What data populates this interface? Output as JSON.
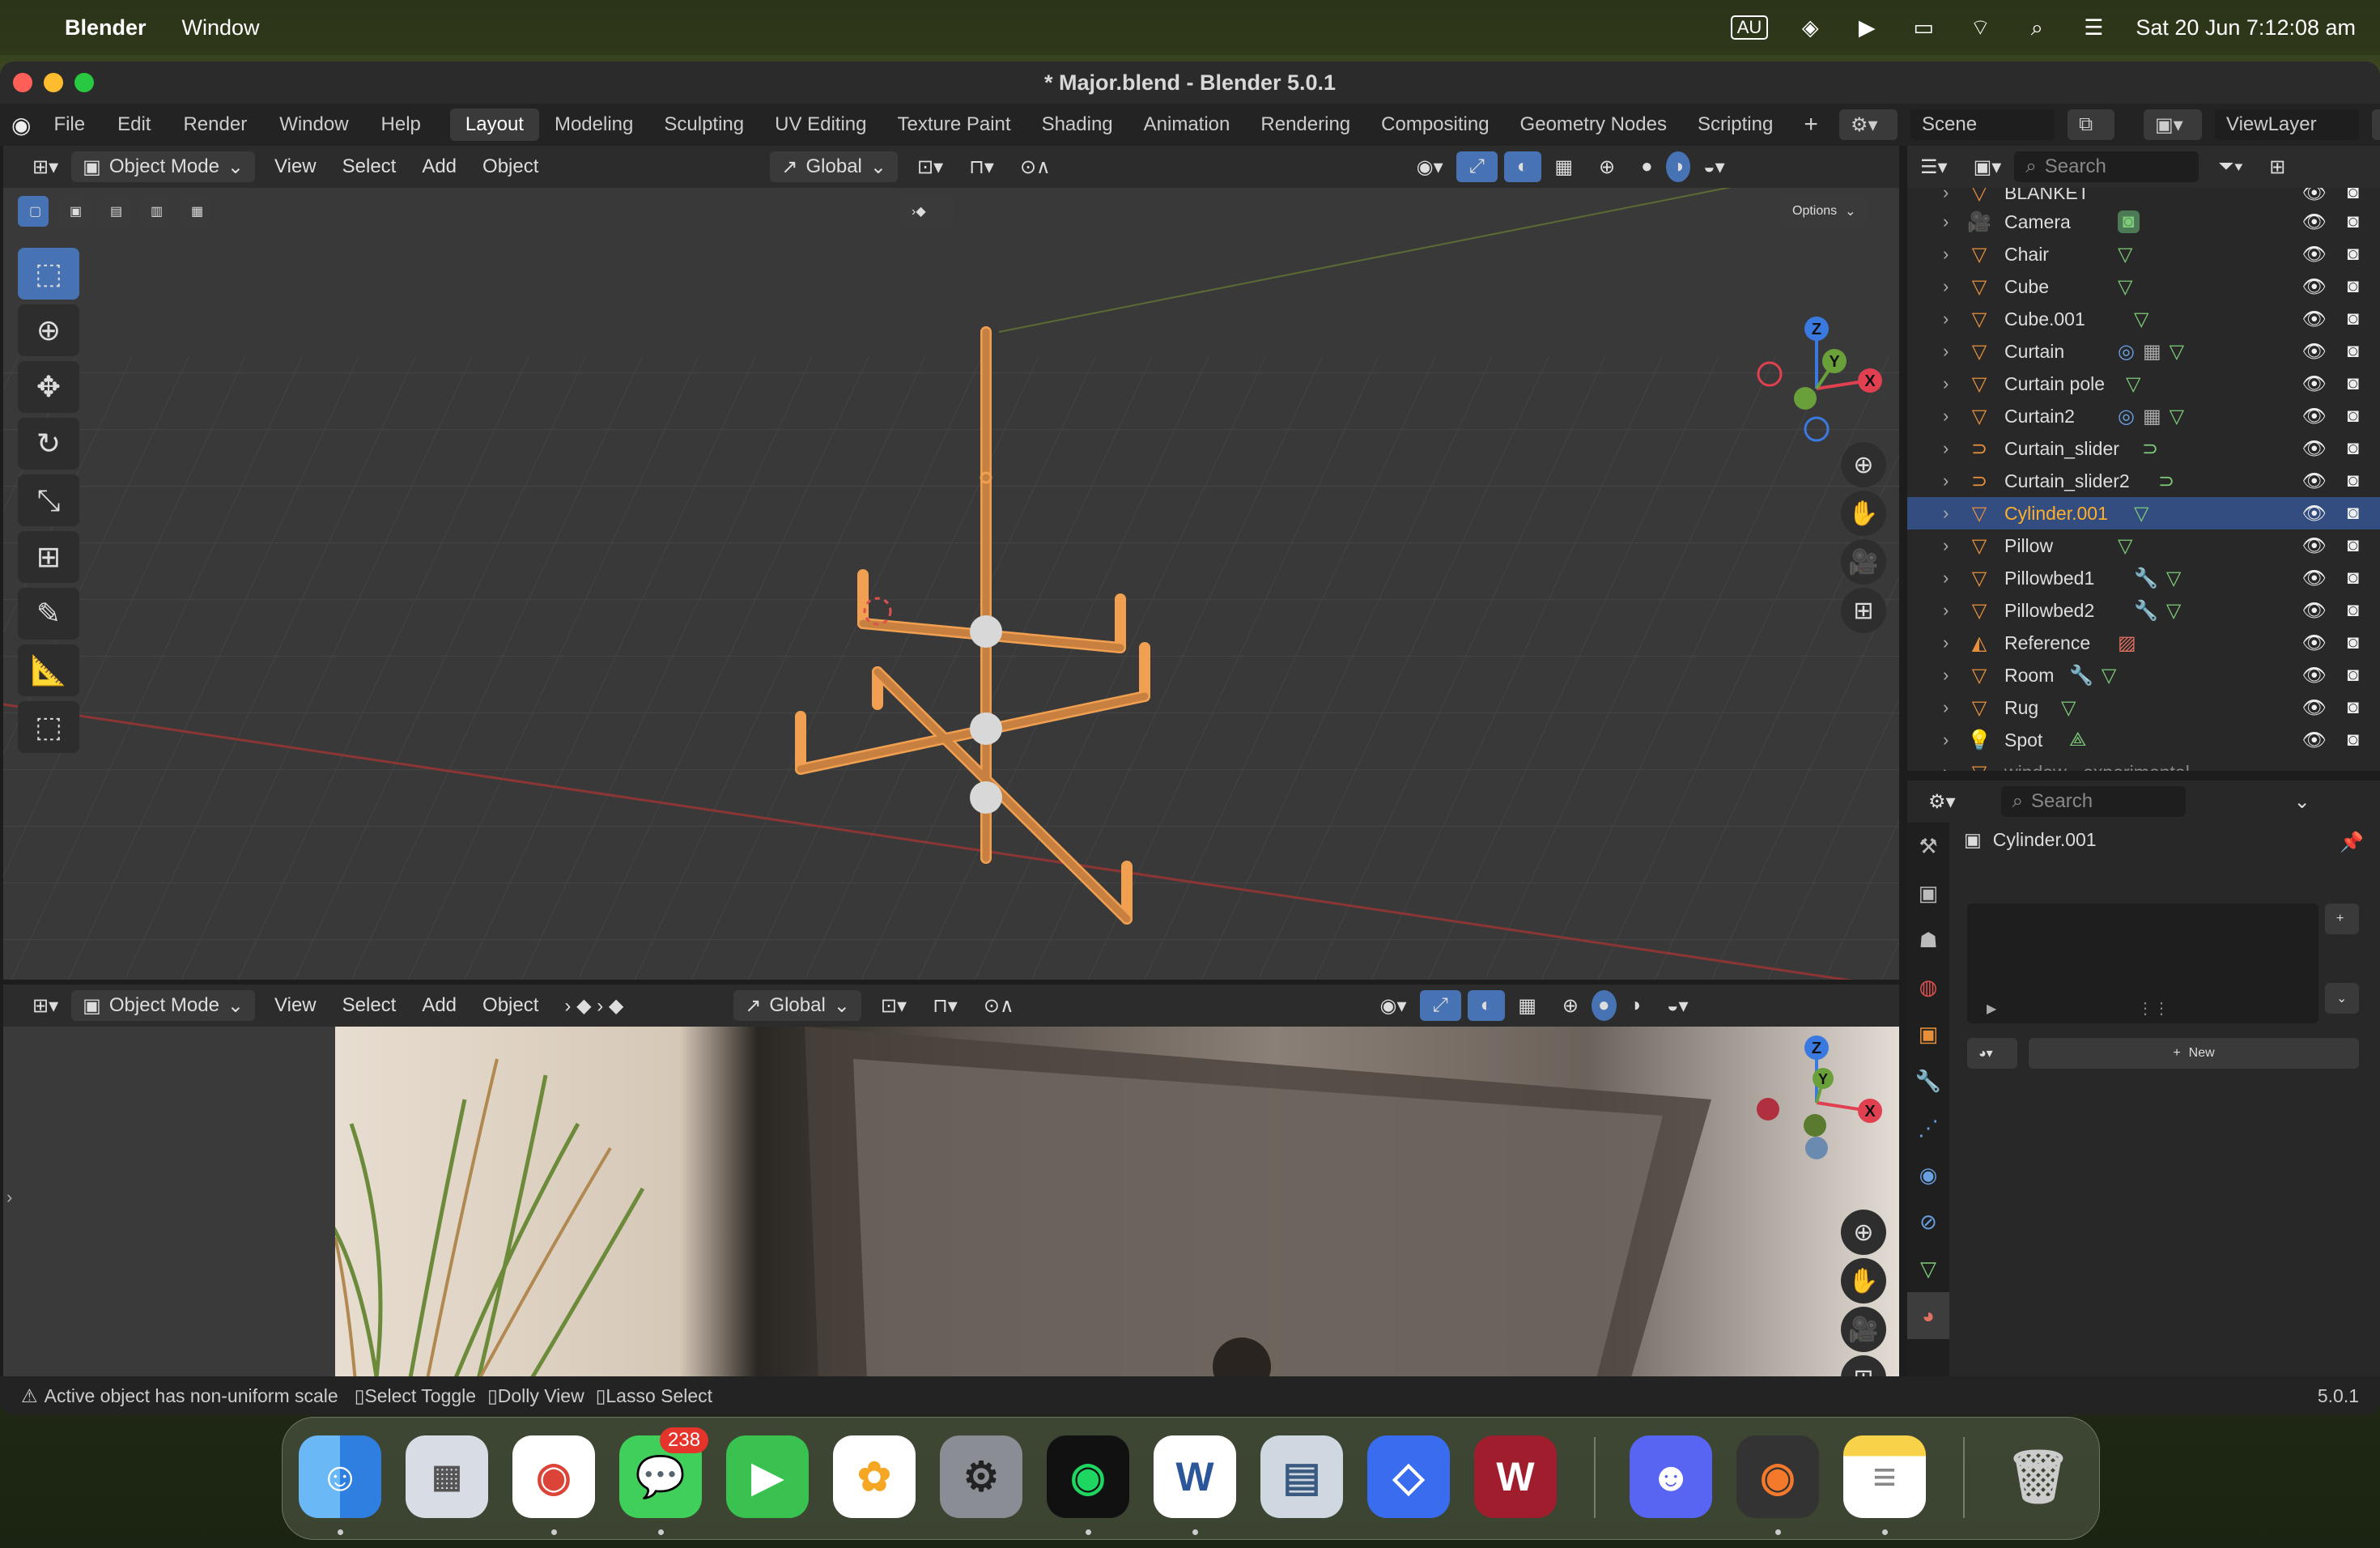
{
  "menubar": {
    "apple": "",
    "app_name": "Blender",
    "menu_window": "Window",
    "locale": "AU",
    "datetime": "Sat 20 Jun  7:12:08 am"
  },
  "window": {
    "title": "* Major.blend - Blender 5.0.1"
  },
  "topbar": {
    "menus": [
      "File",
      "Edit",
      "Render",
      "Window",
      "Help"
    ],
    "workspaces": [
      "Layout",
      "Modeling",
      "Sculpting",
      "UV Editing",
      "Texture Paint",
      "Shading",
      "Animation",
      "Rendering",
      "Compositing",
      "Geometry Nodes",
      "Scripting"
    ],
    "active_workspace": "Layout",
    "add_tab": "+",
    "scene": "Scene",
    "view_layer": "ViewLayer"
  },
  "viewport_top": {
    "mode": "Object Mode",
    "menus": [
      "View",
      "Select",
      "Add",
      "Object"
    ],
    "orientation": "Global",
    "options": "Options",
    "gizmo": {
      "z": "Z",
      "y": "Y",
      "x": "X"
    }
  },
  "viewport_bottom": {
    "mode": "Object Mode",
    "menus": [
      "View",
      "Select",
      "Add",
      "Object"
    ],
    "orientation": "Global",
    "gizmo": {
      "z": "Z",
      "y": "Y",
      "x": "X"
    }
  },
  "outliner": {
    "search_placeholder": "Search",
    "partial_top": "BLANKET",
    "items": [
      {
        "name": "Camera"
      },
      {
        "name": "Chair"
      },
      {
        "name": "Cube"
      },
      {
        "name": "Cube.001"
      },
      {
        "name": "Curtain"
      },
      {
        "name": "Curtain pole"
      },
      {
        "name": "Curtain2"
      },
      {
        "name": "Curtain_slider"
      },
      {
        "name": "Curtain_slider2"
      },
      {
        "name": "Cylinder.001"
      },
      {
        "name": "Pillow"
      },
      {
        "name": "Pillowbed1"
      },
      {
        "name": "Pillowbed2"
      },
      {
        "name": "Reference"
      },
      {
        "name": "Room"
      },
      {
        "name": "Rug"
      },
      {
        "name": "Spot"
      }
    ],
    "selected": "Cylinder.001",
    "partial_bottom": "window - experimental"
  },
  "properties": {
    "search_placeholder": "Search",
    "object_name": "Cylinder.001",
    "new_button": "New"
  },
  "statusbar": {
    "warning": "Active object has non-uniform scale",
    "hint1": "Select Toggle",
    "hint2": "Dolly View",
    "hint3": "Lasso Select",
    "version": "5.0.1"
  },
  "dock": {
    "messages_badge": "238",
    "word_letter": "W",
    "wb_letter": "W"
  }
}
